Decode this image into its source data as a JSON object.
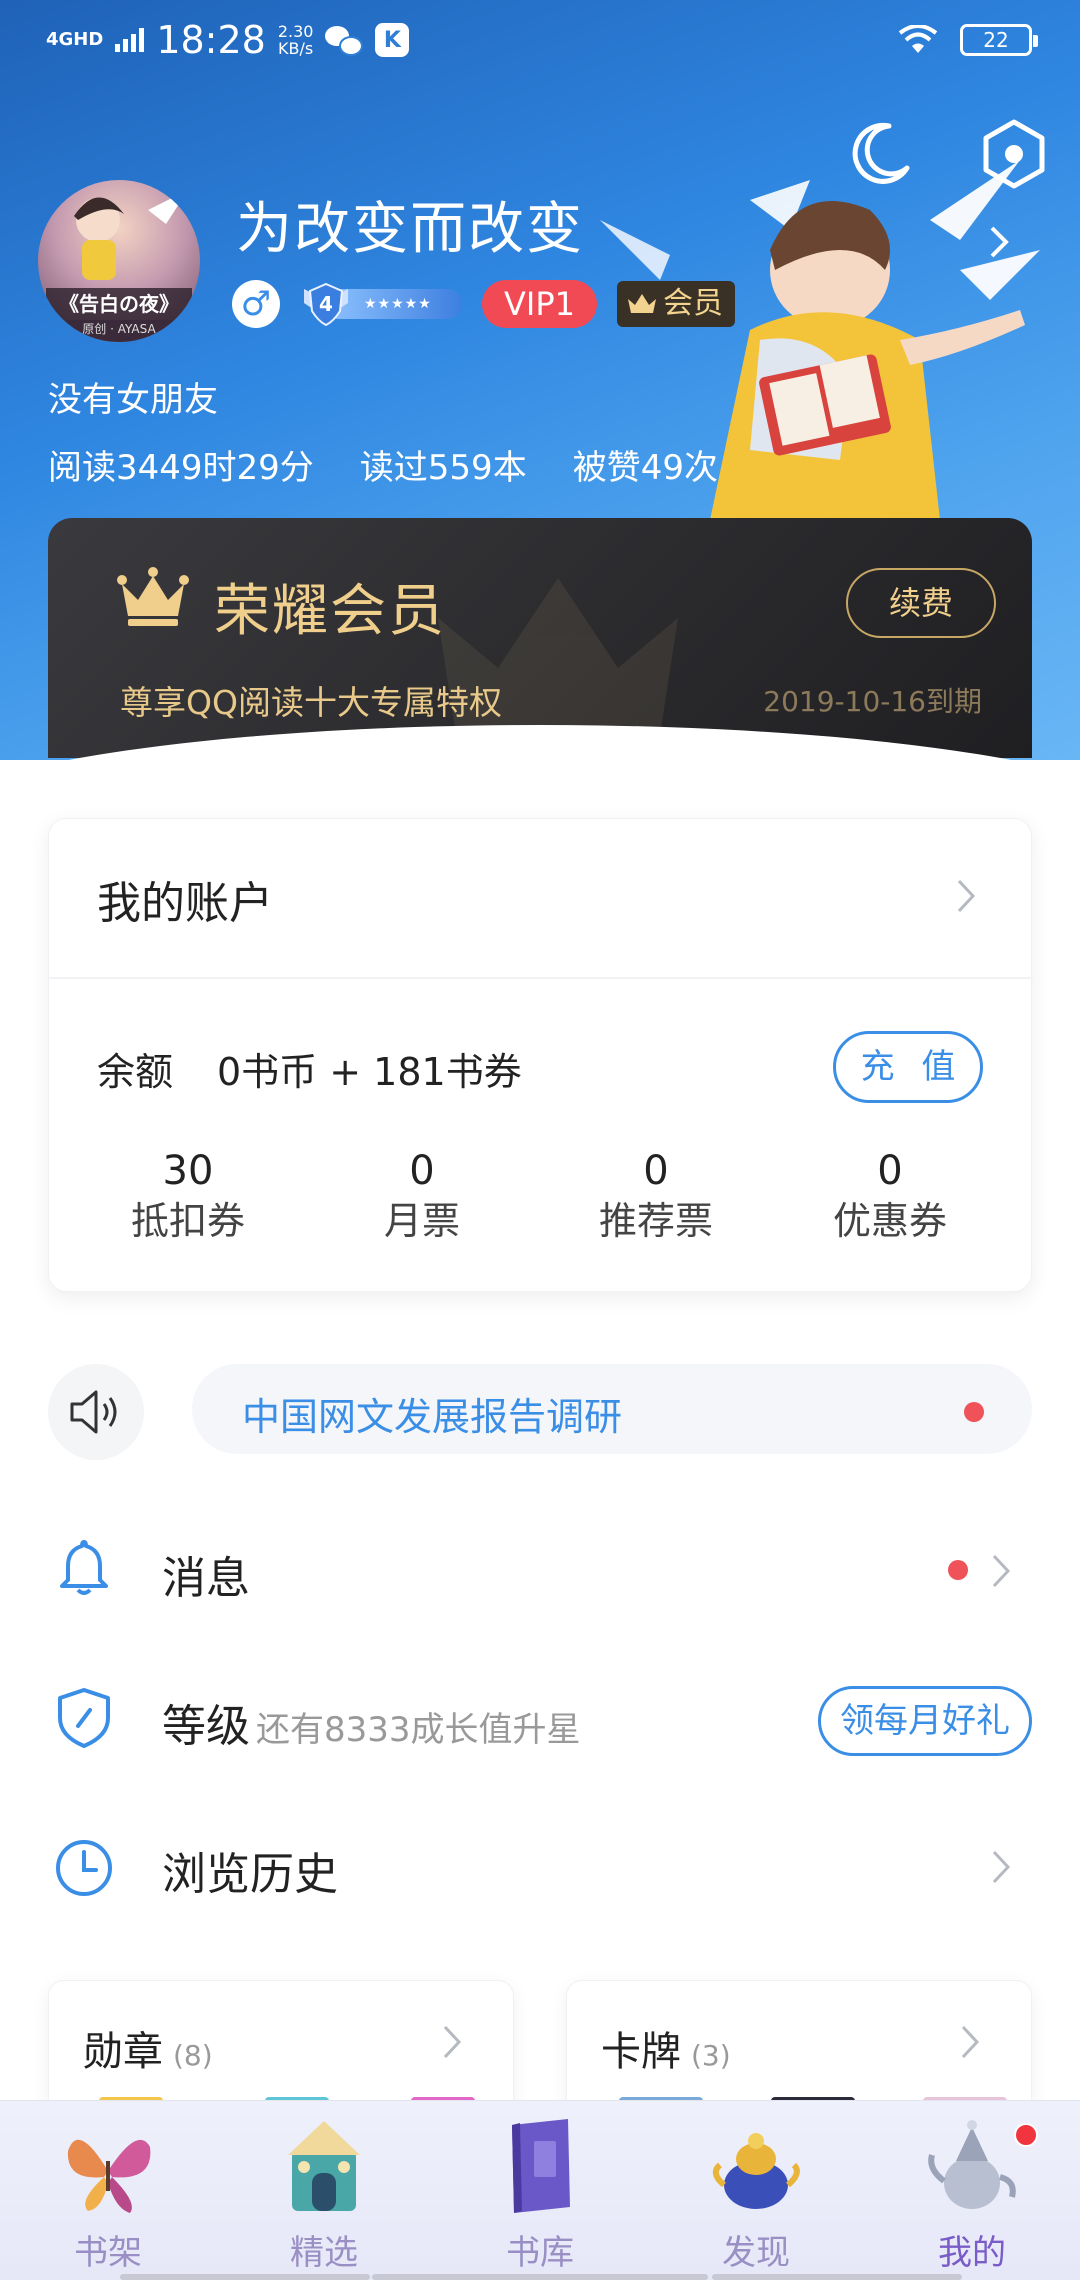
{
  "status_bar": {
    "network": "4GHD",
    "time": "18:28",
    "speed_value": "2.30",
    "speed_unit": "KB/s",
    "app_icon": "K",
    "battery": "22"
  },
  "profile": {
    "avatar_text": "《告白の夜》",
    "avatar_subtext": "原创 · AYASA",
    "username": "为改变而改变",
    "gender_symbol": "♂",
    "level_number": "4",
    "level_stars": "★★★★★",
    "vip_label": "VIP1",
    "member_label": "会员",
    "signature": "没有女朋友",
    "stats": {
      "reading_time": "阅读3449时29分",
      "books_read": "读过559本",
      "likes": "被赞49次"
    }
  },
  "vip_card": {
    "title": "荣耀会员",
    "description": "尊享QQ阅读十大专属特权",
    "expiry": "2019-10-16到期",
    "renew_label": "续费"
  },
  "account": {
    "title": "我的账户",
    "balance_label": "余额",
    "balance_value": "0书币 + 181书券",
    "recharge_label": "充 值",
    "tickets": [
      {
        "value": "30",
        "label": "抵扣券"
      },
      {
        "value": "0",
        "label": "月票"
      },
      {
        "value": "0",
        "label": "推荐票"
      },
      {
        "value": "0",
        "label": "优惠券"
      }
    ]
  },
  "notice": {
    "text": "中国网文发展报告调研"
  },
  "menu": {
    "messages": {
      "label": "消息"
    },
    "level": {
      "label": "等级",
      "sub": "还有8333成长值升星",
      "action": "领每月好礼"
    },
    "history": {
      "label": "浏览历史"
    }
  },
  "medals": {
    "title": "勋章",
    "count": "(8)"
  },
  "cards": {
    "title": "卡牌",
    "count": "(3)"
  },
  "tabbar": {
    "tabs": [
      {
        "label": "书架"
      },
      {
        "label": "精选"
      },
      {
        "label": "书库"
      },
      {
        "label": "发现"
      },
      {
        "label": "我的"
      }
    ],
    "active_index": 4
  },
  "colors": {
    "accent_blue": "#3a8ee6",
    "vip_red": "#f24a55",
    "gold": "#f0cf8c",
    "badge_red": "#f0525a"
  }
}
